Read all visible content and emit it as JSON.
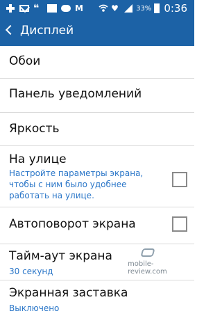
{
  "status_bar": {
    "icons_left": [
      "plus-icon",
      "mail-icon",
      "quote-icon",
      "photo-icon",
      "cloud-icon",
      "m-icon"
    ],
    "icons_right": [
      "wifi-icon",
      "heart-icon",
      "signal-icon"
    ],
    "battery": "33%",
    "time": "0:36"
  },
  "app_bar": {
    "title": "Дисплей"
  },
  "items": [
    {
      "title": "Обои"
    },
    {
      "title": "Панель уведомлений"
    },
    {
      "title": "Яркость"
    },
    {
      "title": "На улице",
      "subtitle": "Настройте параметры экрана, чтобы с ним было удобнее работать на улице.",
      "checked": false
    },
    {
      "title": "Автоповорот экрана",
      "checked": false
    },
    {
      "title": "Тайм-аут экрана",
      "subtitle": "30 секунд"
    },
    {
      "title": "Экранная заставка",
      "subtitle": "Выключено"
    }
  ],
  "watermark": "mobile-review.com",
  "colors": {
    "accent": "#1c62a6",
    "subtitle": "#2a76c8",
    "divider": "#d9d9d9"
  }
}
